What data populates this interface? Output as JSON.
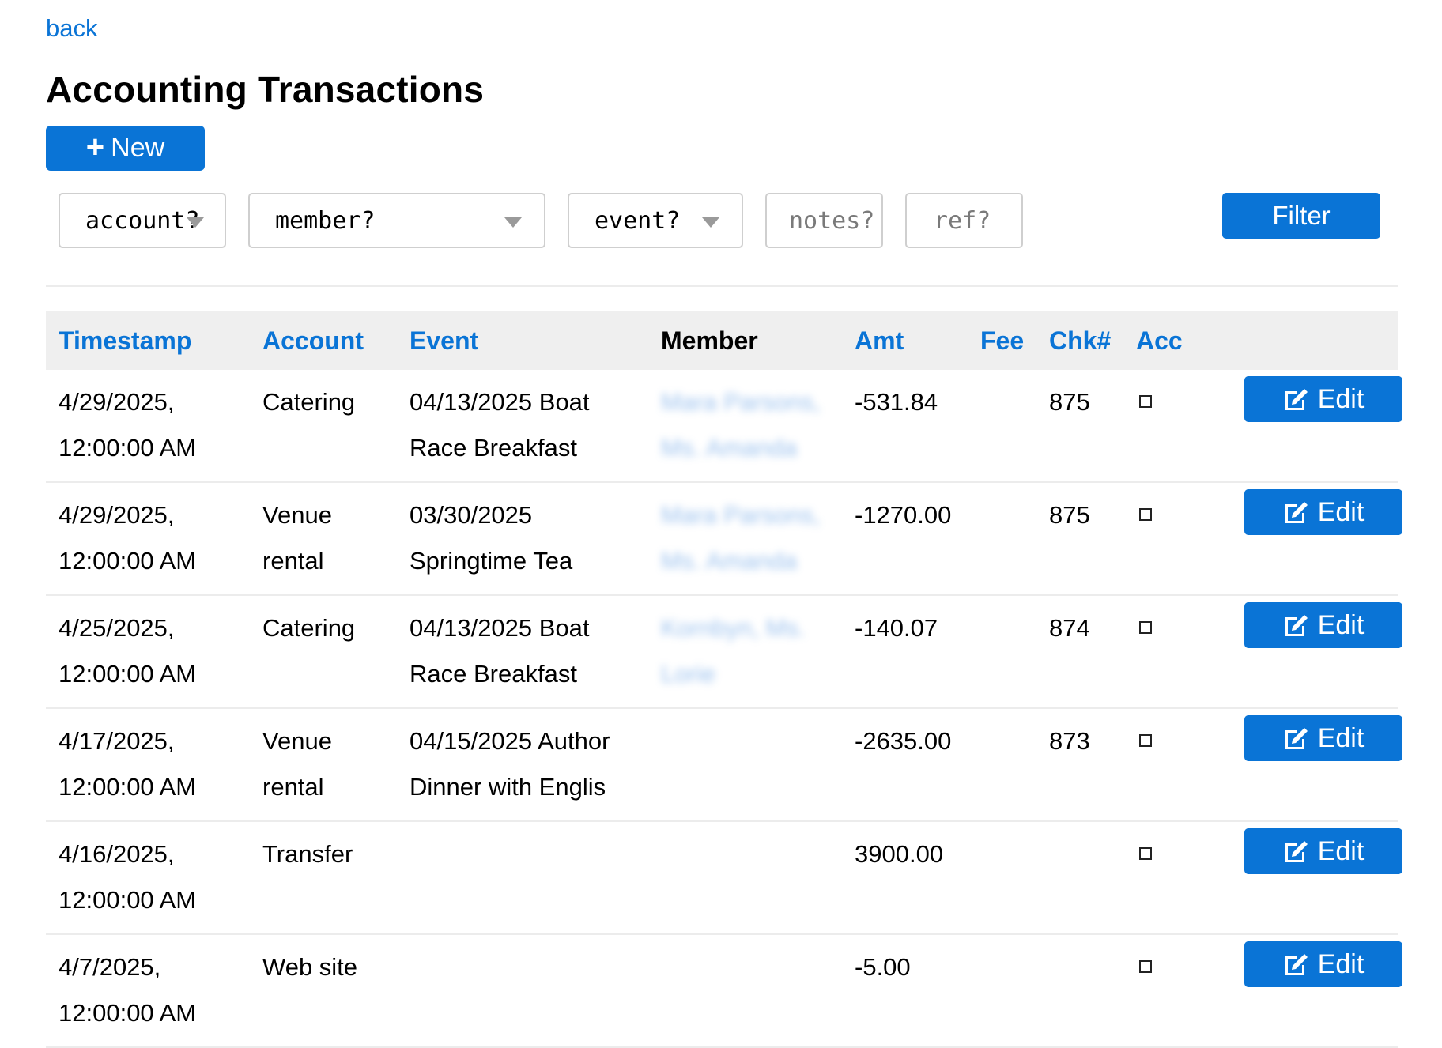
{
  "nav": {
    "back_label": "back"
  },
  "page": {
    "title": "Accounting Transactions"
  },
  "toolbar": {
    "new_label": "New",
    "new_icon": "plus-icon"
  },
  "filters": {
    "account": "account?",
    "member": "member?",
    "event": "event?",
    "notes_placeholder": "notes?",
    "ref_placeholder": "ref?",
    "filter_label": "Filter"
  },
  "table": {
    "headers": {
      "timestamp": "Timestamp",
      "account": "Account",
      "event": "Event",
      "member": "Member",
      "amt": "Amt",
      "fee": "Fee",
      "chk": "Chk#",
      "acc": "Acc"
    },
    "rows": [
      {
        "timestamp_date": "4/29/2025,",
        "timestamp_time": "12:00:00 AM",
        "account_1": "Catering",
        "account_2": "",
        "event_1": "04/13/2025 Boat",
        "event_2": "Race Breakfast",
        "member_1": "Mara Parsons,",
        "member_2": "Ms. Amanda",
        "amt": "-531.84",
        "fee": "",
        "chk": "875",
        "acc": false,
        "edit_label": "Edit"
      },
      {
        "timestamp_date": "4/29/2025,",
        "timestamp_time": "12:00:00 AM",
        "account_1": "Venue",
        "account_2": "rental",
        "event_1": "03/30/2025",
        "event_2": "Springtime Tea",
        "member_1": "Mara Parsons,",
        "member_2": "Ms. Amanda",
        "amt": "-1270.00",
        "fee": "",
        "chk": "875",
        "acc": false,
        "edit_label": "Edit"
      },
      {
        "timestamp_date": "4/25/2025,",
        "timestamp_time": "12:00:00 AM",
        "account_1": "Catering",
        "account_2": "",
        "event_1": "04/13/2025 Boat",
        "event_2": "Race Breakfast",
        "member_1": "Kornbyn, Ms.",
        "member_2": "Lorie",
        "amt": "-140.07",
        "fee": "",
        "chk": "874",
        "acc": false,
        "edit_label": "Edit"
      },
      {
        "timestamp_date": "4/17/2025,",
        "timestamp_time": "12:00:00 AM",
        "account_1": "Venue",
        "account_2": "rental",
        "event_1": "04/15/2025 Author",
        "event_2": "Dinner with Englis",
        "member_1": "",
        "member_2": "",
        "amt": "-2635.00",
        "fee": "",
        "chk": "873",
        "acc": false,
        "edit_label": "Edit"
      },
      {
        "timestamp_date": "4/16/2025,",
        "timestamp_time": "12:00:00 AM",
        "account_1": "Transfer",
        "account_2": "",
        "event_1": "",
        "event_2": "",
        "member_1": "",
        "member_2": "",
        "amt": "3900.00",
        "fee": "",
        "chk": "",
        "acc": false,
        "edit_label": "Edit"
      },
      {
        "timestamp_date": "4/7/2025,",
        "timestamp_time": "12:00:00 AM",
        "account_1": "Web site",
        "account_2": "",
        "event_1": "",
        "event_2": "",
        "member_1": "",
        "member_2": "",
        "amt": "-5.00",
        "fee": "",
        "chk": "",
        "acc": false,
        "edit_label": "Edit"
      }
    ]
  },
  "colors": {
    "accent": "#0a74d6",
    "header_bg": "#efefef",
    "row_border": "#ececec"
  }
}
